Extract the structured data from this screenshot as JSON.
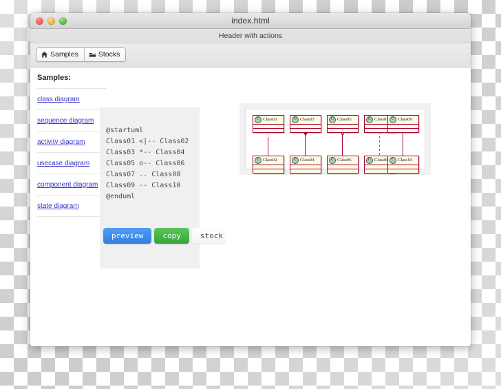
{
  "window": {
    "title": "index.html",
    "subheader": "Header with actions",
    "traffic_lights": [
      "close-button",
      "minimize-button",
      "zoom-button"
    ]
  },
  "toolbar": {
    "buttons": [
      {
        "label": "Samples",
        "icon": "home-icon"
      },
      {
        "label": "Stocks",
        "icon": "folder-icon"
      }
    ]
  },
  "sidebar": {
    "heading": "Samples:",
    "items": [
      {
        "label": "class diagram"
      },
      {
        "label": "sequence diagram"
      },
      {
        "label": "activity diagram"
      },
      {
        "label": "usecase diagram"
      },
      {
        "label": "component diagram"
      },
      {
        "label": "state diagram"
      }
    ]
  },
  "editor": {
    "code": "@startuml\nClass01 <|-- Class02\nClass03 *-- Class04\nClass05 o-- Class06\nClass07 .. Class08\nClass09 -- Class10\n@enduml",
    "lines": [
      "@startuml",
      "Class01 <|-- Class02",
      "Class03 *-- Class04",
      "Class05 o-- Class06",
      "Class07 .. Class08",
      "Class09 -- Class10",
      "@enduml"
    ],
    "actions": [
      {
        "label": "preview",
        "color": "#3b8ff0"
      },
      {
        "label": "copy",
        "color": "#3fae46"
      },
      {
        "label": "stock",
        "color": "#f5f5f5"
      }
    ]
  },
  "diagram": {
    "classes": [
      {
        "name": "Class01",
        "col": 0,
        "row": 0
      },
      {
        "name": "Class02",
        "col": 0,
        "row": 1
      },
      {
        "name": "Class03",
        "col": 1,
        "row": 0
      },
      {
        "name": "Class04",
        "col": 1,
        "row": 1
      },
      {
        "name": "Class05",
        "col": 2,
        "row": 0
      },
      {
        "name": "Class06",
        "col": 2,
        "row": 1
      },
      {
        "name": "Class07",
        "col": 3,
        "row": 0
      },
      {
        "name": "Class08",
        "col": 3,
        "row": 1
      },
      {
        "name": "Class09",
        "col": 4,
        "row": 0
      },
      {
        "name": "Class10",
        "col": 4,
        "row": 1
      }
    ],
    "relations": [
      {
        "from": "Class01",
        "to": "Class02",
        "type": "inheritance",
        "marker": "hollow-triangle"
      },
      {
        "from": "Class03",
        "to": "Class04",
        "type": "composition",
        "marker": "filled-diamond"
      },
      {
        "from": "Class05",
        "to": "Class06",
        "type": "aggregation",
        "marker": "hollow-circle"
      },
      {
        "from": "Class07",
        "to": "Class08",
        "type": "dependency",
        "marker": "dotted-line"
      },
      {
        "from": "Class09",
        "to": "Class10",
        "type": "association",
        "marker": "solid-line"
      }
    ],
    "class_icon_letter": "C",
    "accent_color": "#a80036",
    "class_fill": "#fdfbe4"
  }
}
